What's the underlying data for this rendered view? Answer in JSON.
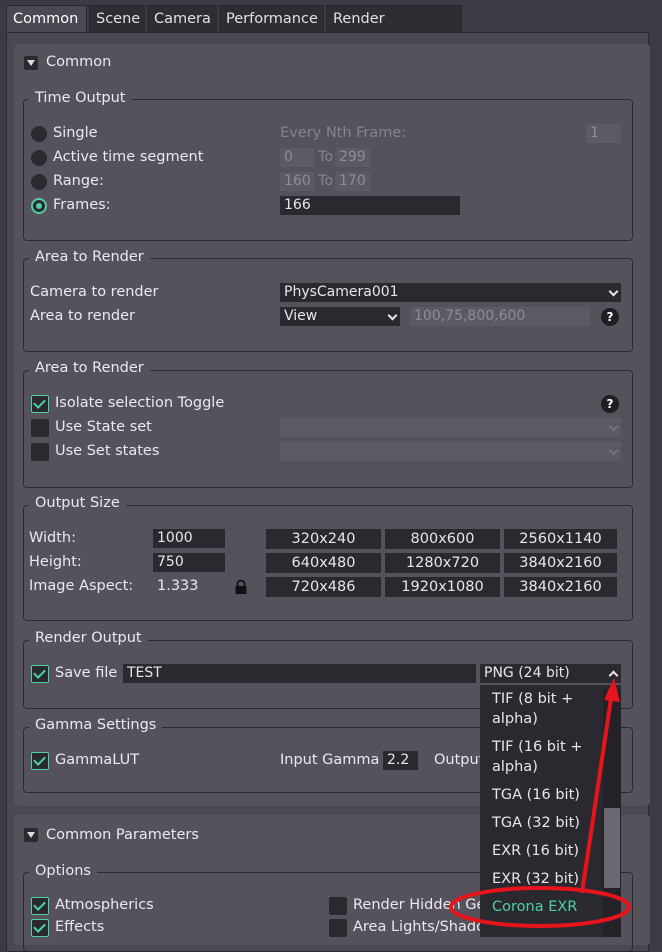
{
  "tabs": [
    "Common",
    "Scene",
    "Camera",
    "Performance",
    "Render Elements"
  ],
  "common_rollout": {
    "title": "Common"
  },
  "time_output": {
    "title": "Time Output",
    "single": "Single",
    "active_segment": "Active time segment",
    "range": "Range:",
    "frames": "Frames:",
    "every_nth": "Every Nth Frame:",
    "every_nth_value": "1",
    "active_from": "0",
    "active_to_label": "To",
    "active_to": "299",
    "range_from": "160",
    "range_to_label": "To",
    "range_to": "170",
    "frames_value": "166"
  },
  "area_render": {
    "title": "Area to Render",
    "camera_label": "Camera to render",
    "camera_value": "PhysCamera001",
    "area_label": "Area to render",
    "area_value": "View",
    "region_value": "100,75,800,600",
    "help": "?"
  },
  "area_render2": {
    "title": "Area to Render",
    "isolate": "Isolate selection Toggle",
    "state_set": "Use State set",
    "set_states": "Use Set states",
    "help": "?"
  },
  "output_size": {
    "title": "Output Size",
    "width_label": "Width:",
    "width_value": "1000",
    "height_label": "Height:",
    "height_value": "750",
    "aspect_label": "Image Aspect:",
    "aspect_value": "1.333",
    "presets": [
      "320x240",
      "800x600",
      "2560x1140",
      "640x480",
      "1280x720",
      "3840x2160",
      "720x486",
      "1920x1080",
      "3840x2160"
    ]
  },
  "render_output": {
    "title": "Render Output",
    "save_file": "Save file",
    "file_value": "TEST",
    "format_value": "PNG (24 bit)"
  },
  "gamma": {
    "title": "Gamma Settings",
    "gamma_lut": "GammaLUT",
    "input_gamma_label": "Input Gamma",
    "input_gamma_value": "2.2",
    "output_label": "Output"
  },
  "format_dropdown": {
    "items": [
      "TIF (8 bit +",
      "alpha)",
      "TIF (16 bit +",
      "alpha)",
      "TGA (16 bit)",
      "TGA (32 bit)",
      "EXR (16 bit)",
      "EXR (32 bit)",
      "Corona EXR"
    ],
    "highlight_color": "#4fcfa6"
  },
  "common_params": {
    "title": "Common Parameters",
    "options_title": "Options",
    "atmospherics": "Atmospherics",
    "effects": "Effects",
    "render_hidden": "Render Hidden Ge",
    "area_lights": "Area Lights/Shado"
  },
  "colors": {
    "accent": "#4fcfa6",
    "annotation": "#e8141c"
  }
}
